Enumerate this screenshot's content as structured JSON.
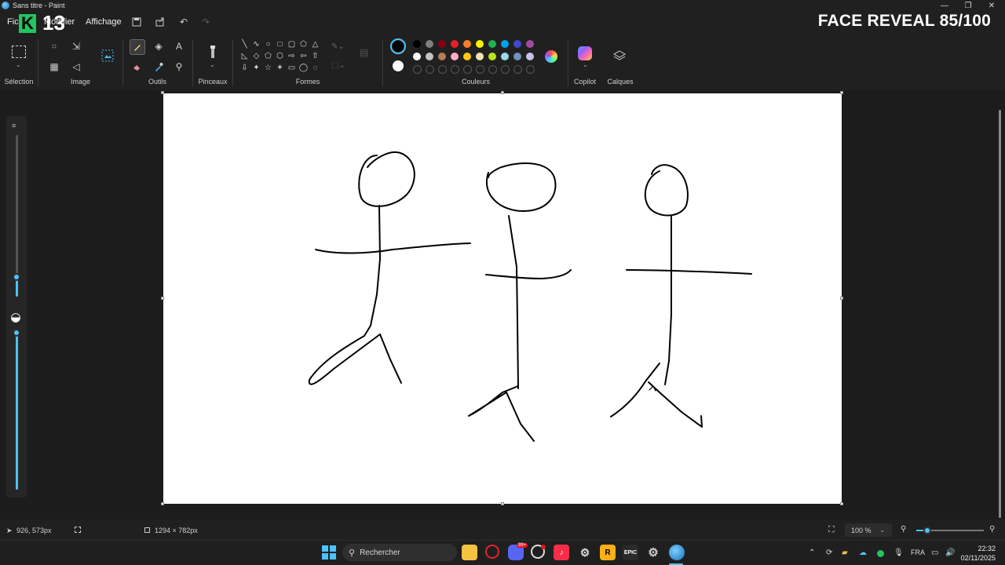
{
  "window": {
    "title": "Sans titre - Paint",
    "minimize_glyph": "—",
    "maximize_glyph": "❐",
    "close_glyph": "✕"
  },
  "menu": {
    "file": "Fichier",
    "edit": "Modifier",
    "view": "Affichage"
  },
  "overlay": {
    "logo_letter": "K",
    "number": "13",
    "banner": "FACE REVEAL 85/100"
  },
  "ribbon": {
    "groups": {
      "selection": "Sélection",
      "image": "Image",
      "tools": "Outils",
      "brushes": "Pinceaux",
      "shapes": "Formes",
      "colors": "Couleurs",
      "copilot": "Copilot",
      "layers": "Calques"
    },
    "shapes_row1": [
      "╲",
      "∿",
      "○",
      "□",
      "▢",
      "⬠",
      "△"
    ],
    "shapes_row2": [
      "◺",
      "◇",
      "⬠",
      "⬡",
      "⇨",
      "⇦",
      "⇧"
    ],
    "shapes_row3": [
      "⇩",
      "✦",
      "☆",
      "✶",
      "▭",
      "◯",
      "◌"
    ],
    "palette_row1": [
      "#000000",
      "#7f7f7f",
      "#880015",
      "#ed1c24",
      "#ff7f27",
      "#fff200",
      "#22b14c",
      "#00a2e8",
      "#3f48cc",
      "#a349a4"
    ],
    "palette_row2": [
      "#ffffff",
      "#c3c3c3",
      "#b97a57",
      "#ffaec9",
      "#ffc90e",
      "#efe4b0",
      "#b5e61d",
      "#99d9ea",
      "#7092be",
      "#c8bfe7"
    ],
    "primary_color": "#000000",
    "secondary_color": "#ffffff",
    "accent": "#4cc2ff"
  },
  "sliders": {
    "size_level": 0.12,
    "opacity_level": 1.0
  },
  "statusbar": {
    "cursor_pos": "926, 573px",
    "canvas_size": "1294 × 782px",
    "zoom": "100 %"
  },
  "taskbar": {
    "search_placeholder": "Rechercher",
    "epic_label": "EPIC",
    "rockstar_label": "R",
    "notification_badge": "99+",
    "language": "FRA",
    "time": "22:32",
    "date": "02/11/2025"
  }
}
